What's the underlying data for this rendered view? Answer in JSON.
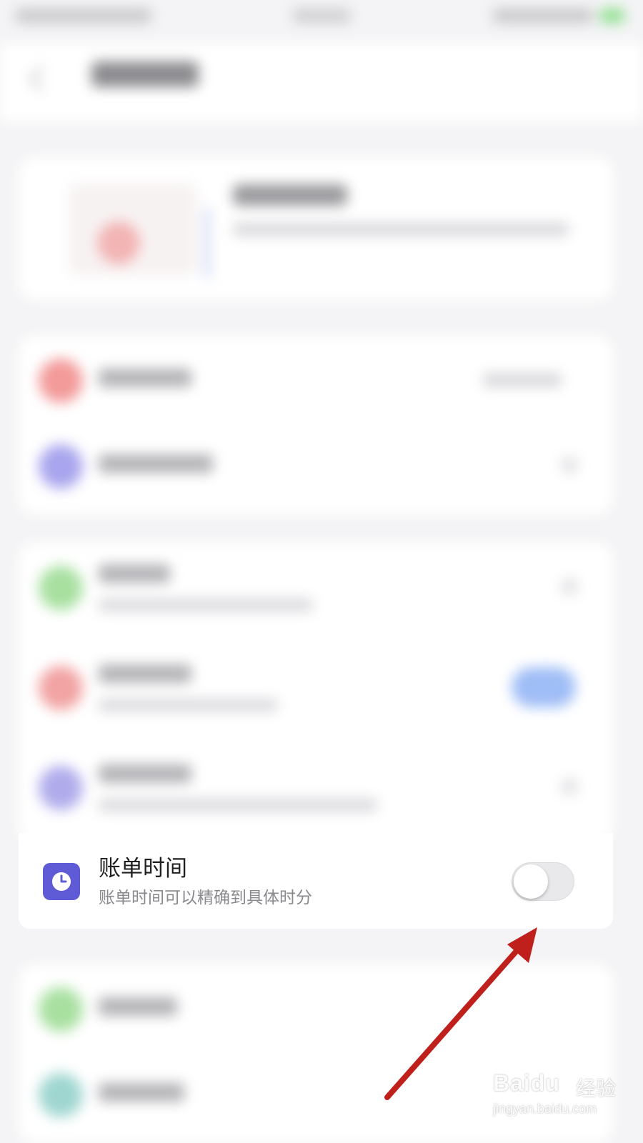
{
  "setting": {
    "title": "账单时间",
    "subtitle": "账单时间可以精确到具体时分",
    "icon": "clock-icon",
    "icon_color": "#5f5bd6",
    "toggle_state": "off"
  },
  "annotation": {
    "arrow_color": "#c0201c"
  },
  "watermark": {
    "brand": "Baidu",
    "brand_cn": "经验",
    "url": "jingyan.baidu.com"
  },
  "colors": {
    "background": "#f4f4f6",
    "card": "#ffffff"
  }
}
